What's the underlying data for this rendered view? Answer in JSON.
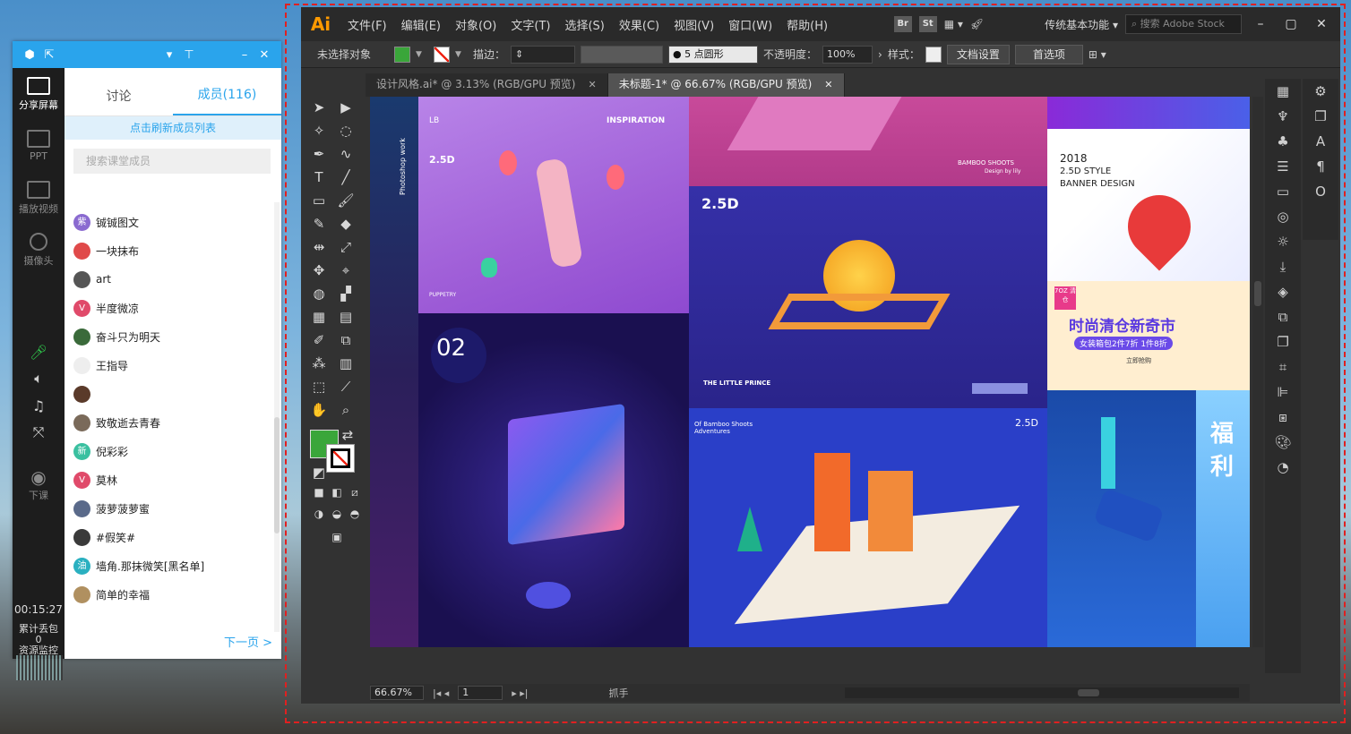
{
  "classroom": {
    "tabs": [
      "讨论",
      "成员(116)"
    ],
    "refresh_label": "点击刷新成员列表",
    "search_placeholder": "搜索课堂成员",
    "side": {
      "share": "分享屏幕",
      "ppt": "PPT",
      "video": "播放视频",
      "camera": "摄像头",
      "leave": "下课",
      "timer": "00:15:27",
      "gift": "累计丢包",
      "gift_count": "0",
      "monitor": "资源监控"
    },
    "members": [
      {
        "name": "铖铖图文",
        "badge": "紫"
      },
      {
        "name": "一块抹布",
        "badge": ""
      },
      {
        "name": "art",
        "badge": ""
      },
      {
        "name": "半度微凉",
        "badge": "V"
      },
      {
        "name": "奋斗只为明天",
        "badge": ""
      },
      {
        "name": "王指导",
        "badge": ""
      },
      {
        "name": "",
        "badge": ""
      },
      {
        "name": "致敬逝去青春",
        "badge": ""
      },
      {
        "name": "倪彩彩",
        "badge": "新"
      },
      {
        "name": "莫林",
        "badge": "V"
      },
      {
        "name": "菠萝菠萝蜜",
        "badge": ""
      },
      {
        "name": "#假笑#",
        "badge": ""
      },
      {
        "name": "墙角.那抹微笑[黑名单]",
        "badge": "油"
      },
      {
        "name": "简单的幸福",
        "badge": ""
      }
    ],
    "next_page": "下一页 >"
  },
  "illustrator": {
    "logo": "Ai",
    "menu": [
      "文件(F)",
      "编辑(E)",
      "对象(O)",
      "文字(T)",
      "选择(S)",
      "效果(C)",
      "视图(V)",
      "窗口(W)",
      "帮助(H)"
    ],
    "br": "Br",
    "st": "St",
    "workspace": "传统基本功能",
    "stock_placeholder": "搜索 Adobe Stock",
    "control": {
      "selection": "未选择对象",
      "stroke_label": "描边：",
      "brush": "5 点圆形",
      "opacity_label": "不透明度：",
      "opacity_value": "100%",
      "style_label": "样式：",
      "doc_setup": "文档设置",
      "prefs": "首选项"
    },
    "doc_tabs": [
      {
        "label": "设计风格.ai* @ 3.13% (RGB/GPU 预览)"
      },
      {
        "label": "未标题-1* @ 66.67% (RGB/GPU 预览)"
      }
    ],
    "status": {
      "zoom": "66.67%",
      "page": "1",
      "tool": "抓手"
    }
  },
  "artboard": {
    "photoshop_work": "Photoshop work",
    "lb": "LB",
    "inspiration": "INSPIRATION",
    "p1": "2.5D",
    "puppetry": "PUPPETRY",
    "num02": "02",
    "bamboo": "BAMBOO SHOOTS",
    "bamboo_sub": "Design by lily",
    "p2": "2.5D",
    "little_prince": "THE LITTLE PRINCE",
    "banner_year": "2018",
    "banner_style": "2.5D STYLE",
    "banner_design": "BANNER DESIGN",
    "sale_badge": "7OZ 清仓",
    "sale_title": "时尚清仓新奇市",
    "sale_sub": "女装箱包2件7折 1件8折",
    "sale_cta": "立即抢购",
    "adventures": "Of Bamboo Shoots Adventures",
    "p3": "2.5D",
    "fu": "福利"
  }
}
